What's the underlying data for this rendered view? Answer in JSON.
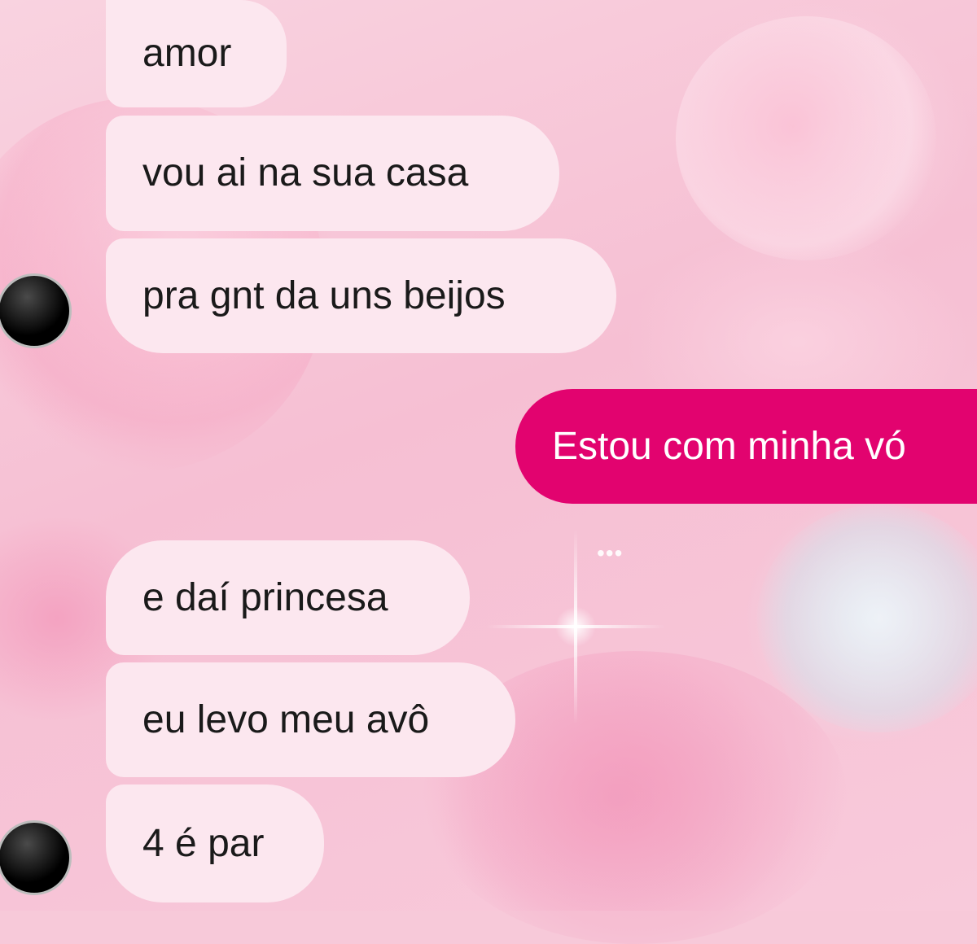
{
  "conversation": {
    "received_group_1": [
      {
        "text": "amor"
      },
      {
        "text": "vou ai na sua casa"
      },
      {
        "text": "pra gnt da uns beijos"
      }
    ],
    "sent": [
      {
        "text": "Estou com minha vó"
      }
    ],
    "typing_indicator": "•••",
    "received_group_2": [
      {
        "text": "e daí princesa"
      },
      {
        "text": "eu levo meu avô"
      },
      {
        "text": "4 é par"
      }
    ]
  },
  "theme": {
    "incoming_bubble_color": "#fce7ef",
    "outgoing_bubble_color": "#e2036f",
    "background": "pink hearts wallpaper"
  }
}
